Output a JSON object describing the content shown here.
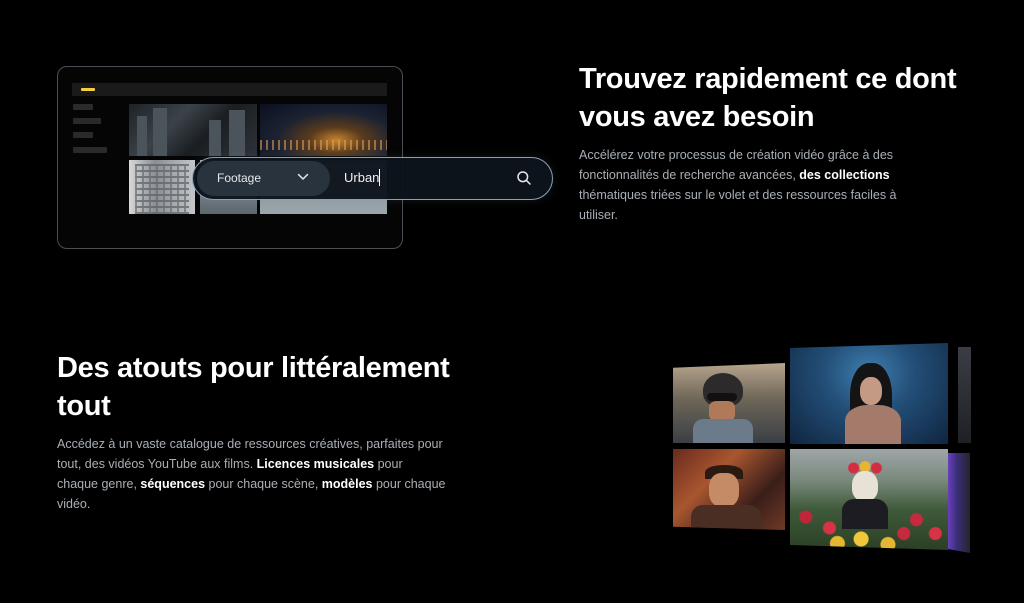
{
  "search_mockup": {
    "filter_label": "Footage",
    "query_value": "Urban",
    "search_icon": "search-icon",
    "chevron_icon": "chevron-down-icon"
  },
  "section_search": {
    "title": "Trouvez rapidement ce dont vous avez besoin",
    "body": {
      "before": "Accélérez votre processus de création vidéo grâce à des fonctionnalités de recherche avancées, ",
      "bold1": "des collections",
      "after": " thématiques triées sur le volet et des ressources faciles à utiliser."
    }
  },
  "section_assets": {
    "title": "Des atouts pour littéralement tout",
    "body": {
      "before": "Accédez à un vaste catalogue de ressources créatives, parfaites pour tout, des vidéos YouTube aux films. ",
      "bold1": "Licences musicales",
      "mid1": " pour chaque genre, ",
      "bold2": "séquences",
      "mid2": " pour chaque scène, ",
      "bold3": "modèles",
      "after": " pour chaque vidéo."
    }
  },
  "colors": {
    "background": "#000000",
    "accent_yellow": "#f4d03f",
    "search_border": "#8aa0b4",
    "body_text": "#a9afb5"
  }
}
